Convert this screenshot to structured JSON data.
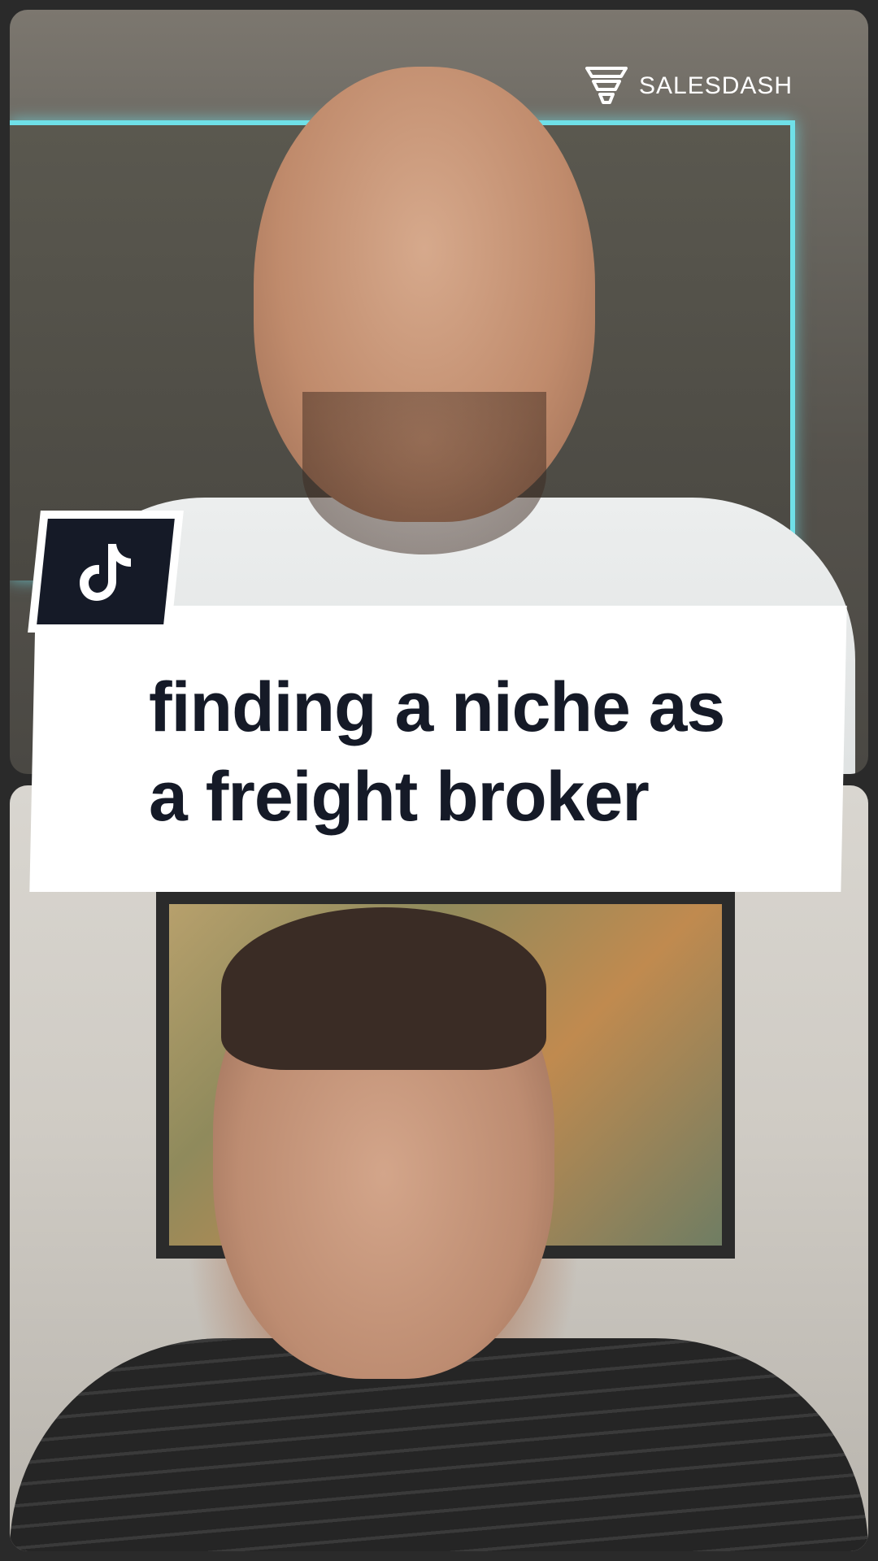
{
  "brand": {
    "name": "SALESDASH",
    "icon": "funnel-logo-icon"
  },
  "badge": {
    "icon": "tiktok-icon"
  },
  "caption": {
    "line1": "finding a niche as",
    "line2": "a freight broker"
  },
  "colors": {
    "caption_text": "#151a27",
    "caption_bg": "#ffffff",
    "badge_bg": "#151a27",
    "window_glow": "#6fe0e8"
  }
}
